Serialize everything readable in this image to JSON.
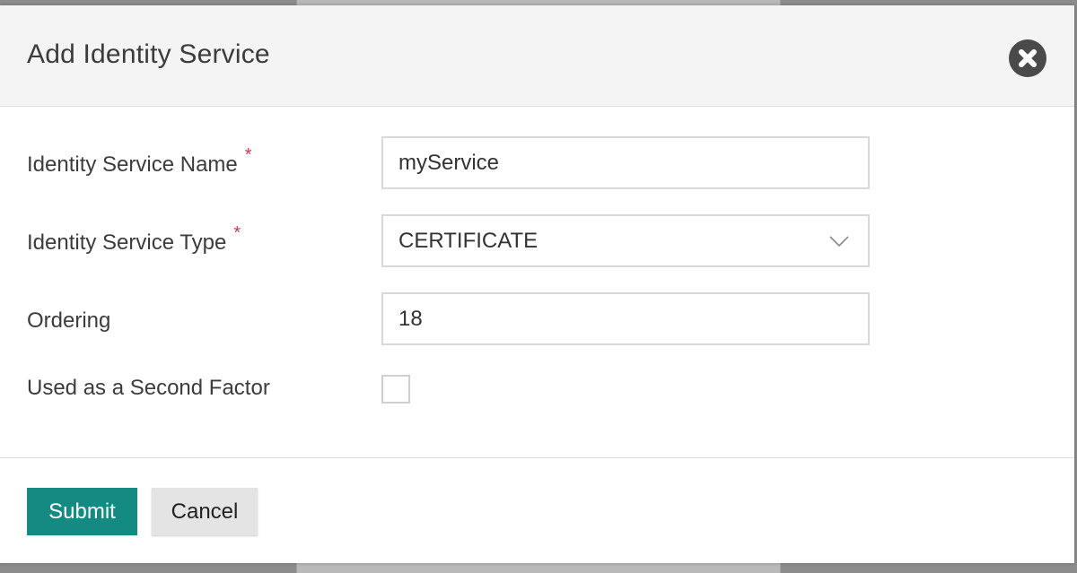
{
  "dialog": {
    "title": "Add Identity Service",
    "close_icon": "close-circle-icon"
  },
  "form": {
    "name_field": {
      "label": "Identity Service Name",
      "required_marker": "*",
      "value": "myService"
    },
    "type_field": {
      "label": "Identity Service Type",
      "required_marker": "*",
      "selected": "CERTIFICATE",
      "dropdown_icon": "chevron-down-icon"
    },
    "ordering_field": {
      "label": "Ordering",
      "value": "18"
    },
    "second_factor_field": {
      "label": "Used as a Second Factor",
      "checked": false
    }
  },
  "footer": {
    "submit_label": "Submit",
    "cancel_label": "Cancel"
  },
  "colors": {
    "primary": "#138a82",
    "required": "#d0384c",
    "header_bg": "#f4f4f4"
  }
}
